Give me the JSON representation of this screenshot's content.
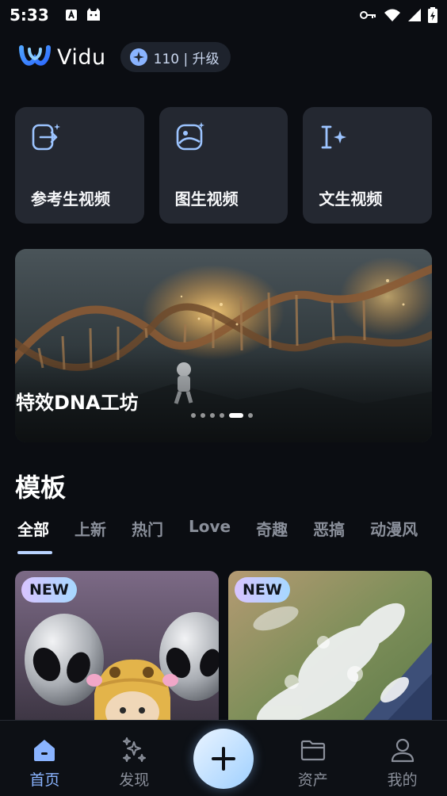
{
  "status_bar": {
    "time": "5:33"
  },
  "header": {
    "app_name": "Vidu",
    "credits": "110 | 升级",
    "accent": "#8ab4ff"
  },
  "features": [
    {
      "label": "参考生视频",
      "icon": "reference-video-icon"
    },
    {
      "label": "图生视频",
      "icon": "image-to-video-icon"
    },
    {
      "label": "文生视频",
      "icon": "text-to-video-icon"
    }
  ],
  "banner": {
    "title": "特效DNA工坊",
    "slide_count": 6,
    "active_slide": 5
  },
  "templates": {
    "title": "模板",
    "tabs": [
      "全部",
      "上新",
      "热门",
      "Love",
      "奇趣",
      "恶搞",
      "动漫风"
    ],
    "active_tab": 0,
    "items": [
      {
        "badge": "NEW",
        "subject": "aliens-with-cat"
      },
      {
        "badge": "NEW",
        "subject": "earth-from-orbit"
      }
    ]
  },
  "bottom_nav": {
    "items": [
      {
        "label": "首页",
        "icon": "home-icon",
        "active": true
      },
      {
        "label": "发现",
        "icon": "sparkle-icon",
        "active": false
      },
      {
        "label": "",
        "icon": "plus-icon",
        "active": false
      },
      {
        "label": "资产",
        "icon": "folder-icon",
        "active": false
      },
      {
        "label": "我的",
        "icon": "user-icon",
        "active": false
      }
    ]
  }
}
